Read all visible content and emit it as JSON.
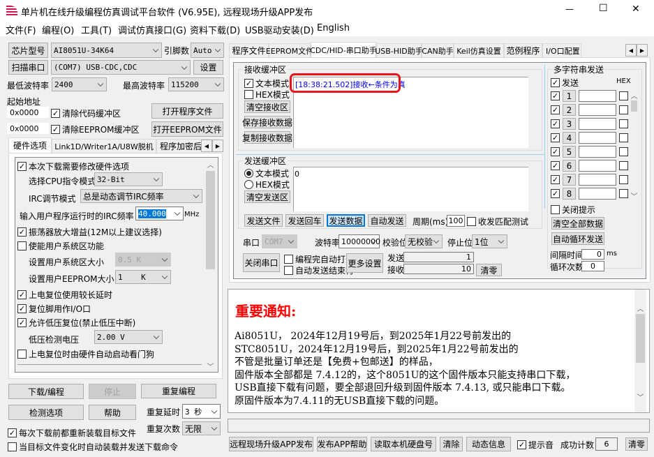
{
  "window": {
    "title": "单片机在线升级编程仿真调试平台软件 (V6.95E), 远程现场升级APP发布",
    "minimize": "—",
    "maximize": "☐",
    "close": "✕"
  },
  "menu": [
    "文件(F)",
    "编程(O)",
    "工具(T)",
    "调试仿真接口(G)",
    "资料下载(D)",
    "USB驱动安装(D)",
    "English"
  ],
  "left": {
    "chip_button": "芯片型号",
    "chip_value": "AI8051U-34K64",
    "pins_label": "引脚数",
    "pins_value": "Auto",
    "scan_button": "扫描串口",
    "port_value": "(COM7) USB-CDC,CDC",
    "settings_button": "设置",
    "min_baud_label": "最低波特率",
    "min_baud_value": "2400",
    "max_baud_label": "最高波特率",
    "max_baud_value": "115200",
    "start_addr_label": "起始地址",
    "addr1": "0x0000",
    "addr2": "0x0000",
    "clear_code": "清除代码缓冲区",
    "clear_code_checked": true,
    "clear_eeprom": "清除EEPROM缓冲区",
    "clear_eeprom_checked": true,
    "open_prog": "打开程序文件",
    "open_eeprom": "打开EEPROM文件",
    "tabs": [
      "硬件选项",
      "Link1D/Writer1A/U8W脱机",
      "程序加密后"
    ],
    "options": {
      "modify_hw": "本次下载需要修改硬件选项",
      "cpu_mode_label": "选择CPU指令模式",
      "cpu_mode": "32-Bit",
      "irc_mode_label": "IRC调节模式",
      "irc_mode": "总是动态调节IRC频率",
      "irc_freq_label": "输入用户程序运行时的IRC频率",
      "irc_freq": "40.000",
      "irc_unit": "MHz",
      "osc_gain": "振荡器放大增益(12M以上建议选择)",
      "user_sys": "使能用户系统区功能",
      "user_sys_size_label": "设置用户系统区大小",
      "user_sys_size": "0.5 K",
      "user_eeprom_label": "设置用户EEPROM大小",
      "user_eeprom": "1    K",
      "long_delay": "上电复位使用较长延时",
      "reset_io": "复位脚用作I/O口",
      "low_volt": "允许低压复位(禁止低压中断)",
      "low_volt_label": "低压检测电压",
      "low_volt_value": "2.00 V",
      "watchdog": "上电复位时由硬件自动启动看门狗"
    },
    "download": "下载/编程",
    "stop": "停止",
    "repeat": "重复编程",
    "detect": "检测选项",
    "help": "帮助",
    "repeat_delay_label": "重复延时",
    "repeat_delay": "3 秒",
    "repeat_count_label": "重复次数",
    "repeat_count": "无限",
    "reload": "每次下载前都重新装载目标文件",
    "auto_load": "当目标文件变化时自动装载并发送下载命令"
  },
  "right": {
    "tabs": [
      "程序文件",
      "EEPROM文件",
      "CDC/HID-串口助手",
      "USB-HID助手",
      "CAN助手",
      "Keil仿真设置",
      "范例程序",
      "I/O口配置"
    ],
    "recv": {
      "title": "接收缓冲区",
      "text_mode": "文本模式",
      "hex_mode": "HEX模式",
      "clear": "清空接收区",
      "save": "保存接收数据",
      "copy": "复制接收数据",
      "content": "[18:38:21.502]接收←条件为真",
      "highlight_color": "#e8141c"
    },
    "send": {
      "title": "发送缓冲区",
      "text_mode": "文本模式",
      "hex_mode": "HEX模式",
      "clear": "清空发送区",
      "content": "0",
      "send_file": "发送文件",
      "send_cr": "发送回车",
      "send_data": "发送数据",
      "auto_send": "自动发送",
      "period_label": "周期(ms)",
      "period": "100",
      "match_test": "收发匹配测试"
    },
    "port_label": "串口",
    "port": "COM7",
    "baud_label": "波特率",
    "baud": "10000000",
    "parity_label": "校验位",
    "parity": "无校验",
    "stop_label": "停止位",
    "stop": "1位",
    "close_port": "关闭串口",
    "auto_open": "编程完自动打开",
    "auto_end": "自动发送结束符",
    "more": "更多设置",
    "sent_label": "发送",
    "sent": "1",
    "recv_label": "接收",
    "recv_count": "10",
    "clear_counts": "清零",
    "multi": {
      "title": "多字符串发送",
      "send_label": "发送",
      "hex_label": "HEX",
      "rows": [
        "1",
        "2",
        "3",
        "4",
        "5",
        "6",
        "7",
        "8"
      ],
      "close_tip": "关闭提示",
      "clear_all": "清空全部数据",
      "auto_loop": "自动循环发送",
      "interval_label": "间隔时间",
      "interval": "0",
      "interval_unit": "ms",
      "loop_label": "循环次数",
      "loop": "0"
    }
  },
  "notice": {
    "title": "重要通知:",
    "title_color": "#ff0000",
    "lines": [
      "Ai8051U， 2024年12月19号后，到2025年1月22号前发出的",
      "STC8051U，2024年12月19号后，到2025年1月22号前发出的",
      "不管是批量订单还是【免费+包邮送】的样品，",
      "固件版本全部都是 7.4.12的，这个8051U的这个固件版本只能支持串口下载，",
      "USB直接下载有问题，要全部退回升级到固件版本 7.4.13, 或只能串口下载。",
      "原固件版本为7.4.11的无USB直接下载的问题。"
    ]
  },
  "bottom": {
    "publish": "远程现场升级APP发布",
    "publish_help": "发布APP帮助",
    "read_disk": "读取本机硬盘号",
    "clear": "清除",
    "dynamic": "动态信息",
    "beep": "提示音",
    "success_label": "成功计数",
    "success": "6",
    "zero": "清零"
  }
}
